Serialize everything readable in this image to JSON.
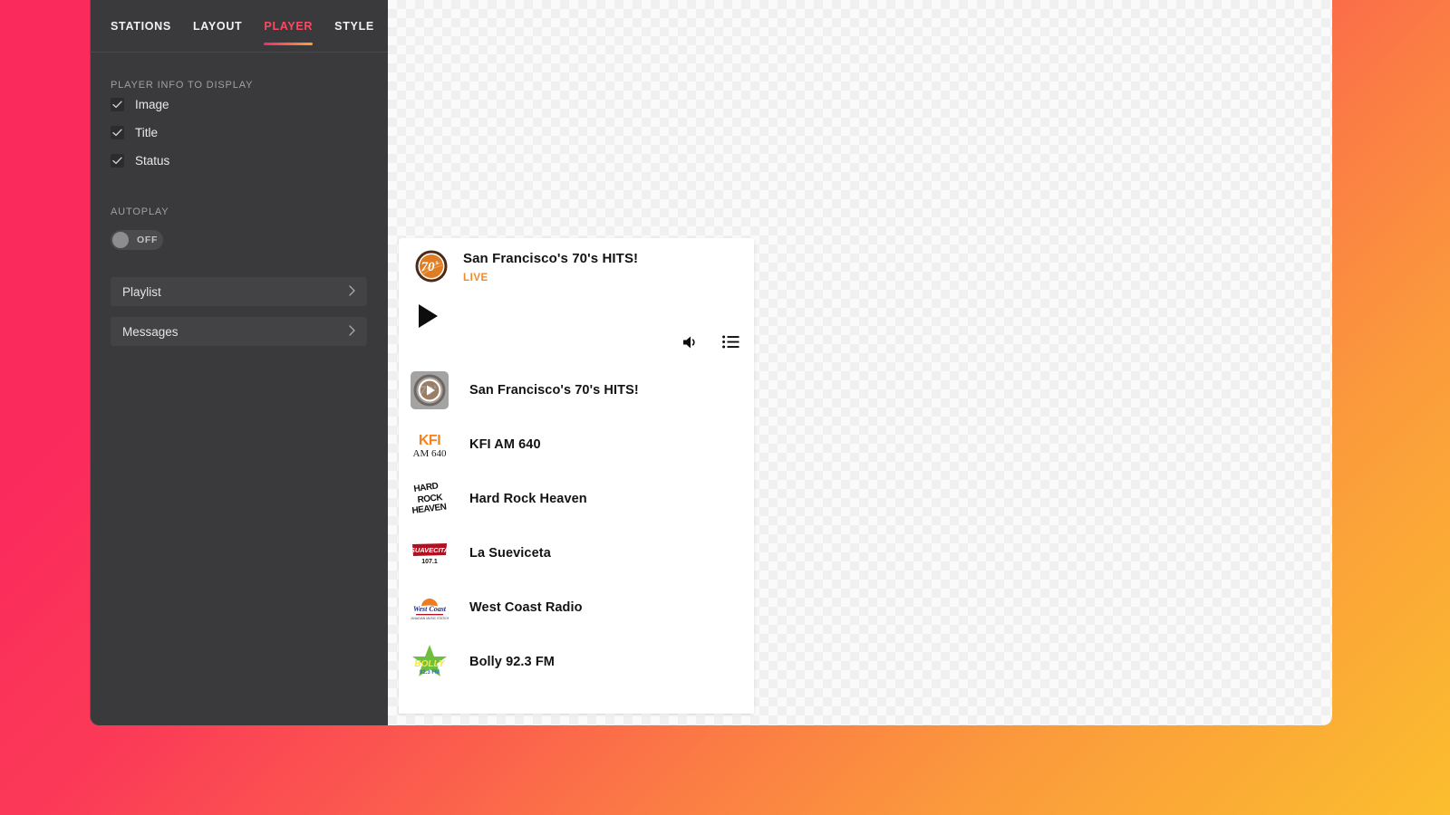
{
  "theme": {
    "accent_pink": "#fb2a5c",
    "accent_orange": "#fbbe2e",
    "panel_bg": "#3a3a3c",
    "tab_active": "#fb4a63",
    "status_color": "#ef8b2a"
  },
  "panel": {
    "tabs": [
      {
        "label": "STATIONS",
        "active": false
      },
      {
        "label": "LAYOUT",
        "active": false
      },
      {
        "label": "PLAYER",
        "active": true
      },
      {
        "label": "STYLE",
        "active": false
      }
    ],
    "player_info_section": {
      "label": "PLAYER INFO TO DISPLAY",
      "options": [
        {
          "label": "Image",
          "checked": true
        },
        {
          "label": "Title",
          "checked": true
        },
        {
          "label": "Status",
          "checked": true
        }
      ]
    },
    "autoplay_section": {
      "label": "AUTOPLAY",
      "toggle_state": "OFF"
    },
    "nav_items": [
      {
        "label": "Playlist",
        "chevron": "chevron-right-icon"
      },
      {
        "label": "Messages",
        "chevron": "chevron-right-icon"
      }
    ]
  },
  "player": {
    "now_playing": {
      "title": "San Francisco's 70's HITS!",
      "status": "LIVE",
      "logo": "seventies-hits-logo"
    },
    "controls": {
      "play": "play-icon",
      "volume": "volume-icon",
      "playlist": "playlist-list-icon"
    },
    "stations": [
      {
        "name": "San Francisco's 70's HITS!",
        "logo": "seventies-hits-logo",
        "playing": true
      },
      {
        "name": "KFI AM 640",
        "logo": "kfi-am-640-logo",
        "playing": false
      },
      {
        "name": "Hard Rock Heaven",
        "logo": "hard-rock-heaven-logo",
        "playing": false
      },
      {
        "name": "La Sueviceta",
        "logo": "la-sueviceta-logo",
        "playing": false
      },
      {
        "name": "West Coast Radio",
        "logo": "west-coast-radio-logo",
        "playing": false
      },
      {
        "name": "Bolly 92.3 FM",
        "logo": "bolly-923-fm-logo",
        "playing": false
      }
    ]
  }
}
